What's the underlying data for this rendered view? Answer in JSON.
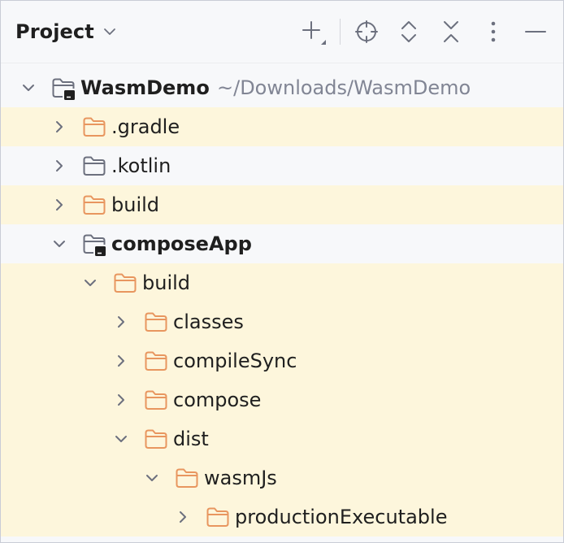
{
  "panel": {
    "title": "Project",
    "toolbar": [
      {
        "name": "add-icon",
        "label": "Add"
      },
      {
        "name": "locate-icon",
        "label": "Select Opened File"
      },
      {
        "name": "expand-all-icon",
        "label": "Expand All"
      },
      {
        "name": "collapse-all-icon",
        "label": "Collapse All"
      },
      {
        "name": "more-options-icon",
        "label": "Options"
      },
      {
        "name": "hide-icon",
        "label": "Hide"
      }
    ]
  },
  "colors": {
    "folder_orange": "#e8965f",
    "folder_gray": "#6c707e",
    "highlight_row": "#fdf6dc",
    "panel_bg": "#f7f8fa",
    "path_text": "#818594"
  },
  "tree": [
    {
      "label": "WasmDemo",
      "path": "~/Downloads/WasmDemo",
      "depth": 0,
      "expanded": true,
      "icon": "module-icon",
      "bold": true,
      "highlight": false
    },
    {
      "label": ".gradle",
      "depth": 1,
      "expanded": false,
      "icon": "folder-orange-icon",
      "bold": false,
      "highlight": true
    },
    {
      "label": ".kotlin",
      "depth": 1,
      "expanded": false,
      "icon": "folder-gray-icon",
      "bold": false,
      "highlight": false
    },
    {
      "label": "build",
      "depth": 1,
      "expanded": false,
      "icon": "folder-orange-icon",
      "bold": false,
      "highlight": true
    },
    {
      "label": "composeApp",
      "depth": 1,
      "expanded": true,
      "icon": "module-icon",
      "bold": true,
      "highlight": false
    },
    {
      "label": "build",
      "depth": 2,
      "expanded": true,
      "icon": "folder-orange-icon",
      "bold": false,
      "highlight": true
    },
    {
      "label": "classes",
      "depth": 3,
      "expanded": false,
      "icon": "folder-orange-icon",
      "bold": false,
      "highlight": true
    },
    {
      "label": "compileSync",
      "depth": 3,
      "expanded": false,
      "icon": "folder-orange-icon",
      "bold": false,
      "highlight": true
    },
    {
      "label": "compose",
      "depth": 3,
      "expanded": false,
      "icon": "folder-orange-icon",
      "bold": false,
      "highlight": true
    },
    {
      "label": "dist",
      "depth": 3,
      "expanded": true,
      "icon": "folder-orange-icon",
      "bold": false,
      "highlight": true
    },
    {
      "label": "wasmJs",
      "depth": 4,
      "expanded": true,
      "icon": "folder-orange-icon",
      "bold": false,
      "highlight": true
    },
    {
      "label": "productionExecutable",
      "depth": 5,
      "expanded": false,
      "icon": "folder-orange-icon",
      "bold": false,
      "highlight": true
    }
  ]
}
